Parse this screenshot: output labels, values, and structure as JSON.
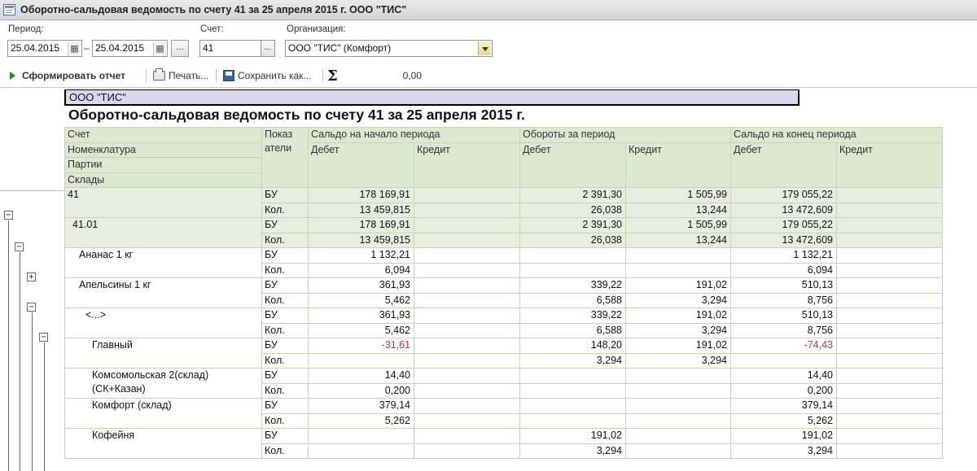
{
  "window": {
    "title": "Оборотно-сальдовая ведомость по счету 41 за 25 апреля 2015 г. ООО \"ТИС\""
  },
  "filters": {
    "period_label": "Период:",
    "date_from": "25.04.2015",
    "date_sep": "–",
    "date_to": "25.04.2015",
    "ellipsis": "...",
    "account_label": "Счет:",
    "account": "41",
    "org_label": "Организация:",
    "org": "ООО \"ТИС\" (Комфорт)"
  },
  "toolbar": {
    "generate": "Сформировать отчет",
    "print": "Печать...",
    "save": "Сохранить как...",
    "sum_symbol": "Σ",
    "sum_value": "0,00"
  },
  "report": {
    "org": "ООО \"ТИС\"",
    "title": "Оборотно-сальдовая ведомость по счету 41 за 25 апреля 2015 г.",
    "headers": {
      "account": "Счет",
      "nomenclature": "Номенклатура",
      "batches": "Партии",
      "warehouses": "Склады",
      "indicators_1": "Показ",
      "indicators_2": "атели",
      "opening": "Сальдо на начало периода",
      "turnover": "Обороты за период",
      "closing": "Сальдо на конец периода",
      "debit": "Дебет",
      "credit": "Кредит"
    },
    "rows": [
      {
        "name": "41",
        "indent": 0,
        "level": 0,
        "lines": [
          {
            "ind": "БУ",
            "od": "178 169,91",
            "oc": "",
            "td": "2 391,30",
            "tc": "1 505,99",
            "cd": "179 055,22",
            "cc": ""
          },
          {
            "ind": "Кол.",
            "od": "13 459,815",
            "oc": "",
            "td": "26,038",
            "tc": "13,244",
            "cd": "13 472,609",
            "cc": ""
          }
        ]
      },
      {
        "name": "41.01",
        "indent": 1,
        "level": 0,
        "lines": [
          {
            "ind": "БУ",
            "od": "178 169,91",
            "oc": "",
            "td": "2 391,30",
            "tc": "1 505,99",
            "cd": "179 055,22",
            "cc": ""
          },
          {
            "ind": "Кол.",
            "od": "13 459,815",
            "oc": "",
            "td": "26,038",
            "tc": "13,244",
            "cd": "13 472,609",
            "cc": ""
          }
        ]
      },
      {
        "name": "Ананас 1 кг",
        "indent": 2,
        "level": 1,
        "lines": [
          {
            "ind": "БУ",
            "od": "1 132,21",
            "oc": "",
            "td": "",
            "tc": "",
            "cd": "1 132,21",
            "cc": ""
          },
          {
            "ind": "Кол.",
            "od": "6,094",
            "oc": "",
            "td": "",
            "tc": "",
            "cd": "6,094",
            "cc": ""
          }
        ]
      },
      {
        "name": "Апельсины 1 кг",
        "indent": 2,
        "level": 1,
        "lines": [
          {
            "ind": "БУ",
            "od": "361,93",
            "oc": "",
            "td": "339,22",
            "tc": "191,02",
            "cd": "510,13",
            "cc": ""
          },
          {
            "ind": "Кол.",
            "od": "5,462",
            "oc": "",
            "td": "6,588",
            "tc": "3,294",
            "cd": "8,756",
            "cc": ""
          }
        ]
      },
      {
        "name": "<...>",
        "indent": 3,
        "level": 1,
        "lines": [
          {
            "ind": "БУ",
            "od": "361,93",
            "oc": "",
            "td": "339,22",
            "tc": "191,02",
            "cd": "510,13",
            "cc": ""
          },
          {
            "ind": "Кол.",
            "od": "5,462",
            "oc": "",
            "td": "6,588",
            "tc": "3,294",
            "cd": "8,756",
            "cc": ""
          }
        ]
      },
      {
        "name": "Главный",
        "indent": 4,
        "level": 1,
        "lines": [
          {
            "ind": "БУ",
            "od": "-31,61",
            "oc": "",
            "td": "148,20",
            "tc": "191,02",
            "cd": "-74,43",
            "cc": ""
          },
          {
            "ind": "Кол.",
            "od": "",
            "oc": "",
            "td": "3,294",
            "tc": "3,294",
            "cd": "",
            "cc": ""
          }
        ]
      },
      {
        "name": "Комсомольская 2(склад)",
        "name2": "(СК+Казан)",
        "indent": 4,
        "level": 1,
        "lines": [
          {
            "ind": "БУ",
            "od": "14,40",
            "oc": "",
            "td": "",
            "tc": "",
            "cd": "14,40",
            "cc": ""
          },
          {
            "ind": "Кол.",
            "od": "0,200",
            "oc": "",
            "td": "",
            "tc": "",
            "cd": "0,200",
            "cc": ""
          }
        ]
      },
      {
        "name": "Комфорт (склад)",
        "indent": 4,
        "level": 1,
        "lines": [
          {
            "ind": "БУ",
            "od": "379,14",
            "oc": "",
            "td": "",
            "tc": "",
            "cd": "379,14",
            "cc": ""
          },
          {
            "ind": "Кол.",
            "od": "5,262",
            "oc": "",
            "td": "",
            "tc": "",
            "cd": "5,262",
            "cc": ""
          }
        ]
      },
      {
        "name": "Кофейня",
        "indent": 4,
        "level": 1,
        "lines": [
          {
            "ind": "БУ",
            "od": "",
            "oc": "",
            "td": "191,02",
            "tc": "",
            "cd": "191,02",
            "cc": ""
          },
          {
            "ind": "Кол.",
            "od": "",
            "oc": "",
            "td": "3,294",
            "tc": "",
            "cd": "3,294",
            "cc": ""
          }
        ]
      }
    ],
    "tree_toggles": {
      "expanded": "−",
      "collapsed": "+"
    }
  },
  "colors": {
    "header_bg": "#dde8d2",
    "group_bg": "#e7eee0",
    "grid_line": "#c6d4b8",
    "org_header_bg": "#d6d8f0",
    "negative": "#d43030"
  }
}
